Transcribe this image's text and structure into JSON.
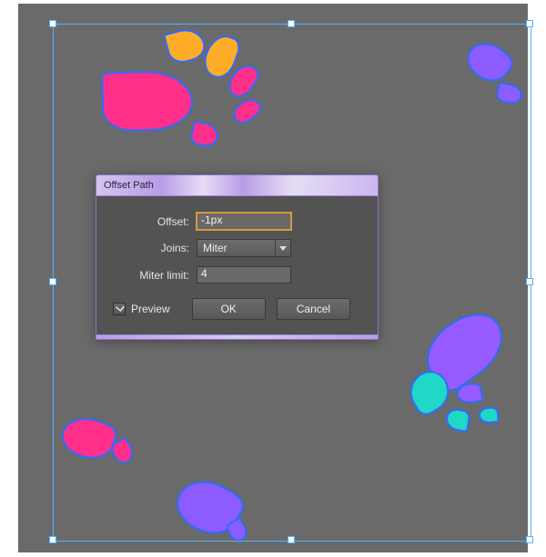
{
  "dialog": {
    "title": "Offset Path",
    "offset_label": "Offset:",
    "offset_value": "-1px",
    "joins_label": "Joins:",
    "joins_value": "Miter",
    "miter_limit_label": "Miter limit:",
    "miter_limit_value": "4",
    "preview_label": "Preview",
    "preview_checked": true,
    "ok_label": "OK",
    "cancel_label": "Cancel"
  },
  "colors": {
    "canvas_bg": "#6b6a6b",
    "selection": "#4fb2ff",
    "dialog_bg": "#535353",
    "titlebar_violet": "#b89de6",
    "orange": "#ffad29",
    "pink": "#ff2f8a",
    "violet": "#8c5cff",
    "teal": "#21d7c6"
  }
}
